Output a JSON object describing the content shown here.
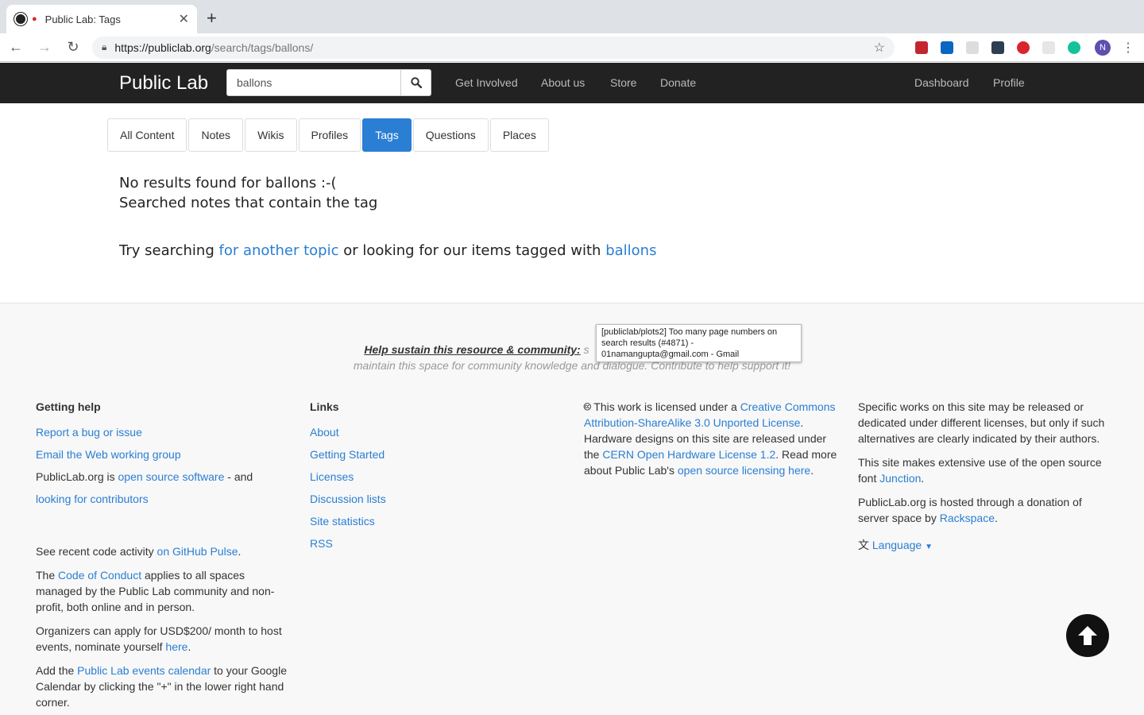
{
  "browser": {
    "tab_title": "Public Lab: Tags",
    "new_tab": "+",
    "close": "✕",
    "url_scheme_host": "https://publiclab.org",
    "url_path": "/search/tags/ballons/",
    "profile_initial": "N"
  },
  "navbar": {
    "brand": "Public Lab",
    "search_value": "ballons",
    "links": [
      "Get Involved",
      "About us",
      "Store",
      "Donate"
    ],
    "right_links": [
      "Dashboard",
      "Profile"
    ]
  },
  "pills": [
    {
      "label": "All Content",
      "active": false
    },
    {
      "label": "Notes",
      "active": false
    },
    {
      "label": "Wikis",
      "active": false
    },
    {
      "label": "Profiles",
      "active": false
    },
    {
      "label": "Tags",
      "active": true
    },
    {
      "label": "Questions",
      "active": false
    },
    {
      "label": "Places",
      "active": false
    }
  ],
  "results": {
    "no_results": "No results found for ballons :-(",
    "searched": "Searched notes that contain the tag",
    "try_prefix": "Try searching ",
    "try_link1": "for another topic",
    "try_middle": " or looking for our items tagged with ",
    "try_link2": "ballons"
  },
  "footer": {
    "sustain_bold": "Help sustain this resource & community:",
    "sustain_rest": " s",
    "sustain_line2": "maintain this space for community knowledge and dialogue. Contribute to help support it!",
    "tooltip": "[publiclab/plots2] Too many page numbers on search results (#4871) - 01namangupta@gmail.com - Gmail",
    "getting_help": {
      "heading": "Getting help",
      "link1": "Report a bug or issue",
      "link2": "Email the Web working group",
      "oss_prefix": "PublicLab.org is ",
      "oss_link": "open source software",
      "oss_suffix": " - and",
      "contrib_link": "looking for contributors",
      "pulse_prefix": "See recent code activity ",
      "pulse_link": "on GitHub Pulse",
      "pulse_suffix": ".",
      "coc_prefix": "The ",
      "coc_link": "Code of Conduct",
      "coc_suffix": " applies to all spaces managed by the Public Lab community and non-profit, both online and in person.",
      "org_text": "Organizers can apply for USD$200/ month to host events, nominate yourself ",
      "org_link": "here",
      "org_suffix": ".",
      "cal_prefix": "Add the ",
      "cal_link": "Public Lab events calendar",
      "cal_suffix": " to your Google Calendar by clicking the \"+\" in the lower right hand corner."
    },
    "links": {
      "heading": "Links",
      "items": [
        "About",
        "Getting Started",
        "Licenses",
        "Discussion lists",
        "Site statistics",
        "RSS"
      ]
    },
    "license": {
      "cc_icon": "cc-icon",
      "t1": " This work is licensed under a ",
      "l1": "Creative Commons Attribution-ShareAlike 3.0 Unported License",
      "t2": ". Hardware designs on this site are released under the ",
      "l2": "CERN Open Hardware License 1.2",
      "t3": ". Read more about Public Lab's ",
      "l3": "open source licensing here",
      "t4": "."
    },
    "specific": {
      "p1": "Specific works on this site may be released or dedicated under different licenses, but only if such alternatives are clearly indicated by their authors.",
      "p2_prefix": "This site makes extensive use of the open source font ",
      "p2_link": "Junction",
      "p2_suffix": ".",
      "p3_prefix": "PublicLab.org is hosted through a donation of server space by ",
      "p3_link": "Rackspace",
      "p3_suffix": ".",
      "language": "Language"
    }
  }
}
